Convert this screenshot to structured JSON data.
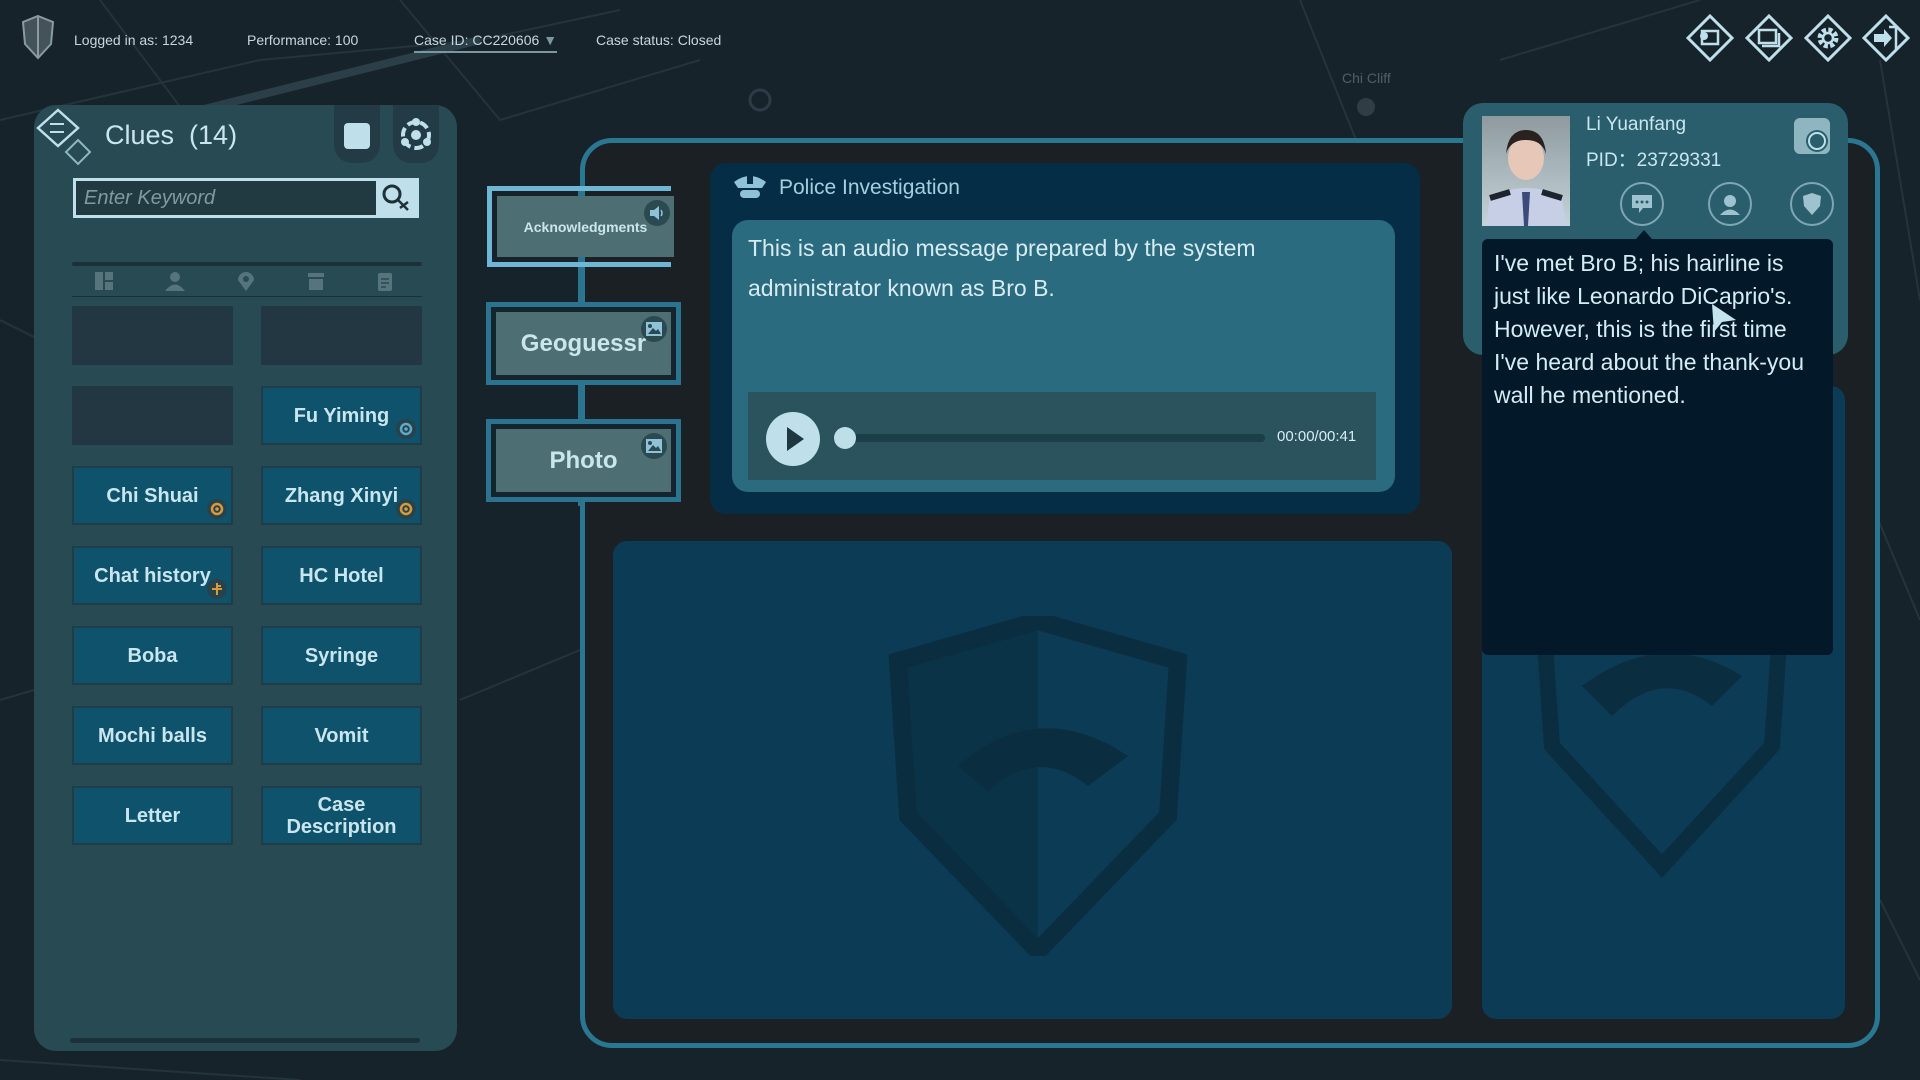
{
  "topbar": {
    "logged_in": "Logged in as: 1234",
    "performance": "Performance: 100",
    "case_id": "Case ID: CC220606",
    "case_status": "Case status: Closed",
    "icons": [
      "case-folder-icon",
      "windows-icon",
      "gear-icon",
      "exit-icon"
    ]
  },
  "map": {
    "label": "Chi Cliff"
  },
  "clues": {
    "title": "Clues",
    "count": "(14)",
    "search_placeholder": "Enter Keyword",
    "tabs": [
      "all-icon",
      "person-icon",
      "location-icon",
      "item-icon",
      "document-icon"
    ],
    "items": [
      {
        "label": ""
      },
      {
        "label": ""
      },
      {
        "label": ""
      },
      {
        "label": "Fu Yiming",
        "badge": "eye"
      },
      {
        "label": "Chi Shuai",
        "badge": "target"
      },
      {
        "label": "Zhang Xinyi",
        "badge": "target"
      },
      {
        "label": "Chat history",
        "badge": "usb"
      },
      {
        "label": "HC Hotel"
      },
      {
        "label": "Boba"
      },
      {
        "label": "Syringe"
      },
      {
        "label": "Mochi balls"
      },
      {
        "label": "Vomit"
      },
      {
        "label": "Letter"
      },
      {
        "label": "Case Description"
      }
    ],
    "badge_colors": {
      "eye": "#5fa8c8",
      "target": "#d99a3a",
      "usb": "#d99a3a"
    }
  },
  "nodes": [
    {
      "label": "Acknowledgments",
      "icon": "speaker-icon"
    },
    {
      "label": "Geoguessr",
      "icon": "image-icon"
    },
    {
      "label": "Photo",
      "icon": "image-icon"
    }
  ],
  "investigation": {
    "title": "Police Investigation",
    "text": "This is an audio message prepared by the system administrator known as Bro B.",
    "audio_time": "00:00/00:41",
    "progress": 0
  },
  "profile": {
    "name": "Li Yuanfang",
    "pid": "PID：23729331",
    "actions": [
      "chat-icon",
      "support-agent-icon",
      "police-shield-icon"
    ]
  },
  "dialog": {
    "text": "I've met Bro B; his hairline is just like Leonardo DiCaprio's. However, this is the first time I've heard about the thank-you wall he mentioned."
  }
}
